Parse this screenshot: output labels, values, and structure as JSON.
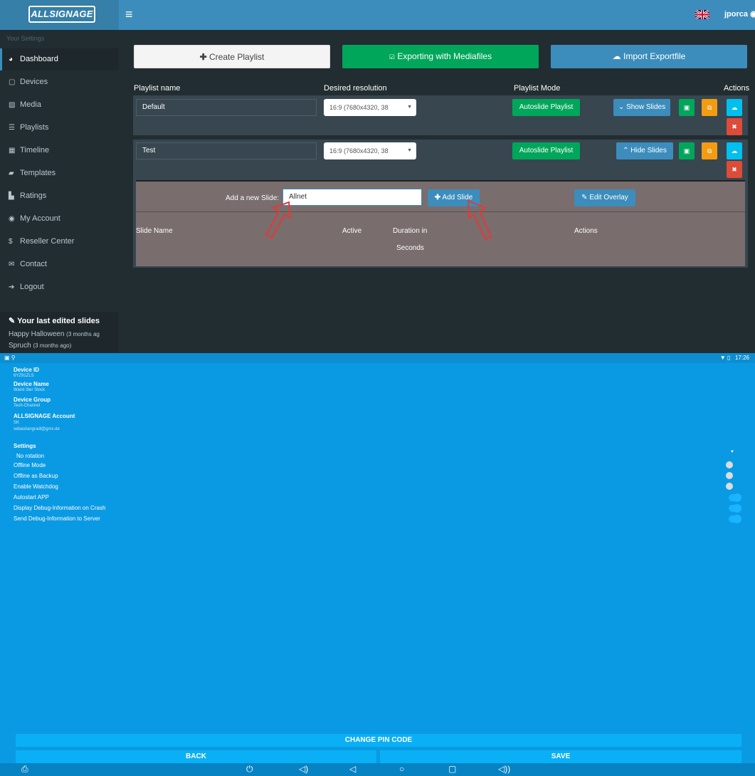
{
  "web": {
    "brand": "ALLSIGNAGE",
    "username": "jporca",
    "sidebar_heading": "Your Settings",
    "sidebar": [
      {
        "label": "Dashboard",
        "icon": "dashboard-icon",
        "glyph": "◕"
      },
      {
        "label": "Devices",
        "icon": "tablet-icon",
        "glyph": "▢"
      },
      {
        "label": "Media",
        "icon": "image-icon",
        "glyph": "▨"
      },
      {
        "label": "Playlists",
        "icon": "list-icon",
        "glyph": "☰"
      },
      {
        "label": "Timeline",
        "icon": "calendar-icon",
        "glyph": "▦"
      },
      {
        "label": "Templates",
        "icon": "folder-icon",
        "glyph": "▰"
      },
      {
        "label": "Ratings",
        "icon": "bar-chart-icon",
        "glyph": "▙"
      },
      {
        "label": "My Account",
        "icon": "user-icon",
        "glyph": "◉"
      },
      {
        "label": "Reseller Center",
        "icon": "dollar-icon",
        "glyph": "$"
      },
      {
        "label": "Contact",
        "icon": "envelope-icon",
        "glyph": "✉"
      },
      {
        "label": "Logout",
        "icon": "sign-out-icon",
        "glyph": "➔"
      }
    ],
    "last_edited": {
      "title": "Your last edited slides",
      "items": [
        {
          "name": "Happy Halloween",
          "ago": "(3 months ag"
        },
        {
          "name": "Spruch",
          "ago": "(3 months ago)"
        }
      ]
    },
    "buttons": {
      "create_playlist": "Create Playlist",
      "exporting": "Exporting with Mediafiles",
      "import": "Import Exportfile"
    },
    "columns": {
      "name": "Playlist name",
      "resolution": "Desired resolution",
      "mode": "Playlist Mode",
      "actions": "Actions"
    },
    "playlists": [
      {
        "name": "Default",
        "resolution": "16:9 (7680x4320, 38",
        "mode": "Autoslide Playlist",
        "toggle": "Show Slides"
      },
      {
        "name": "Test",
        "resolution": "16:9 (7680x4320, 38",
        "mode": "Autoslide Playlist",
        "toggle": "Hide Slides"
      }
    ],
    "slides_panel": {
      "add_label": "Add a new Slide:",
      "input_value": "Allnet",
      "add_button": "Add Slide",
      "edit_overlay": "Edit Overlay",
      "headers": {
        "name": "Slide Name",
        "active": "Active",
        "duration": "Duration in",
        "duration2": "Seconds",
        "actions": "Actions"
      }
    },
    "colors": {
      "primary": "#3c8dbc",
      "success": "#00a65a",
      "warning": "#f39c12",
      "danger": "#dd4b39",
      "sidebar": "#222d32",
      "annotation_arrow": "#e53935"
    }
  },
  "android": {
    "time": "17:26",
    "device_id_label": "Device ID",
    "device_id": "6YZ91ZLS",
    "device_name_label": "Device Name",
    "device_name": "Wand 3ter Stock",
    "device_group_label": "Device Group",
    "device_group": "Tech-Channel",
    "account_label": "ALLSIGNAGE Account",
    "account_short": "SK",
    "account_email": "sebastiangradl@gmx.de",
    "settings_label": "Settings",
    "rotation": "No rotation",
    "settings": [
      {
        "label": "Offline Mode",
        "on": false
      },
      {
        "label": "Offline as Backup",
        "on": false
      },
      {
        "label": "Enable Watchdog",
        "on": false
      },
      {
        "label": "Autostart APP",
        "on": true
      },
      {
        "label": "Display Debug-Information on Crash",
        "on": true
      },
      {
        "label": "Send Debug-Information to Server",
        "on": true
      }
    ],
    "change_pin": "CHANGE PIN CODE",
    "back": "BACK",
    "save": "SAVE"
  }
}
